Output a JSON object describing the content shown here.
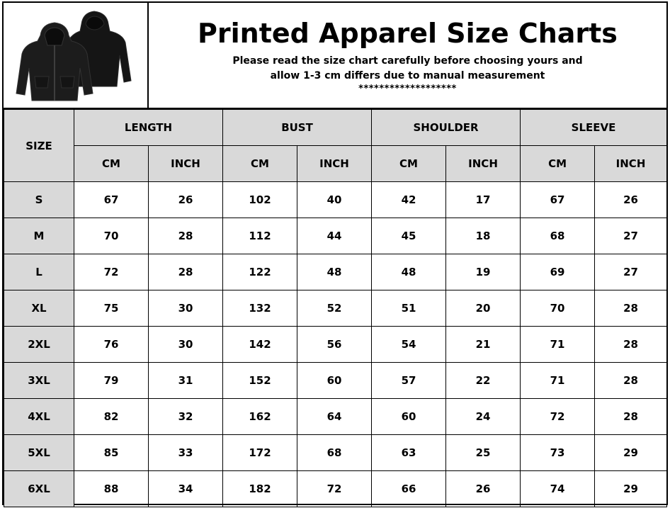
{
  "header": {
    "title": "Printed Apparel Size Charts",
    "subtitle_line1": "Please read the size chart carefully before choosing yours and",
    "subtitle_line2": "allow 1-3 cm differs due to manual measurement",
    "stars": "*******************"
  },
  "product_image": {
    "icon": "hoodie-icon",
    "color": "#111111"
  },
  "table": {
    "size_header": "SIZE",
    "groups": [
      "LENGTH",
      "BUST",
      "SHOULDER",
      "SLEEVE"
    ],
    "units": [
      "CM",
      "INCH",
      "CM",
      "INCH",
      "CM",
      "INCH",
      "CM",
      "INCH"
    ],
    "rows": [
      {
        "size": "S",
        "values": [
          "67",
          "26",
          "102",
          "40",
          "42",
          "17",
          "67",
          "26"
        ]
      },
      {
        "size": "M",
        "values": [
          "70",
          "28",
          "112",
          "44",
          "45",
          "18",
          "68",
          "27"
        ]
      },
      {
        "size": "L",
        "values": [
          "72",
          "28",
          "122",
          "48",
          "48",
          "19",
          "69",
          "27"
        ]
      },
      {
        "size": "XL",
        "values": [
          "75",
          "30",
          "132",
          "52",
          "51",
          "20",
          "70",
          "28"
        ]
      },
      {
        "size": "2XL",
        "values": [
          "76",
          "30",
          "142",
          "56",
          "54",
          "21",
          "71",
          "28"
        ]
      },
      {
        "size": "3XL",
        "values": [
          "79",
          "31",
          "152",
          "60",
          "57",
          "22",
          "71",
          "28"
        ]
      },
      {
        "size": "4XL",
        "values": [
          "82",
          "32",
          "162",
          "64",
          "60",
          "24",
          "72",
          "28"
        ]
      },
      {
        "size": "5XL",
        "values": [
          "85",
          "33",
          "172",
          "68",
          "63",
          "25",
          "73",
          "29"
        ]
      },
      {
        "size": "6XL",
        "values": [
          "88",
          "34",
          "182",
          "72",
          "66",
          "26",
          "74",
          "29"
        ]
      }
    ]
  },
  "colors": {
    "header_fill": "#d9d9d9",
    "border": "#000000",
    "background": "#ffffff"
  }
}
